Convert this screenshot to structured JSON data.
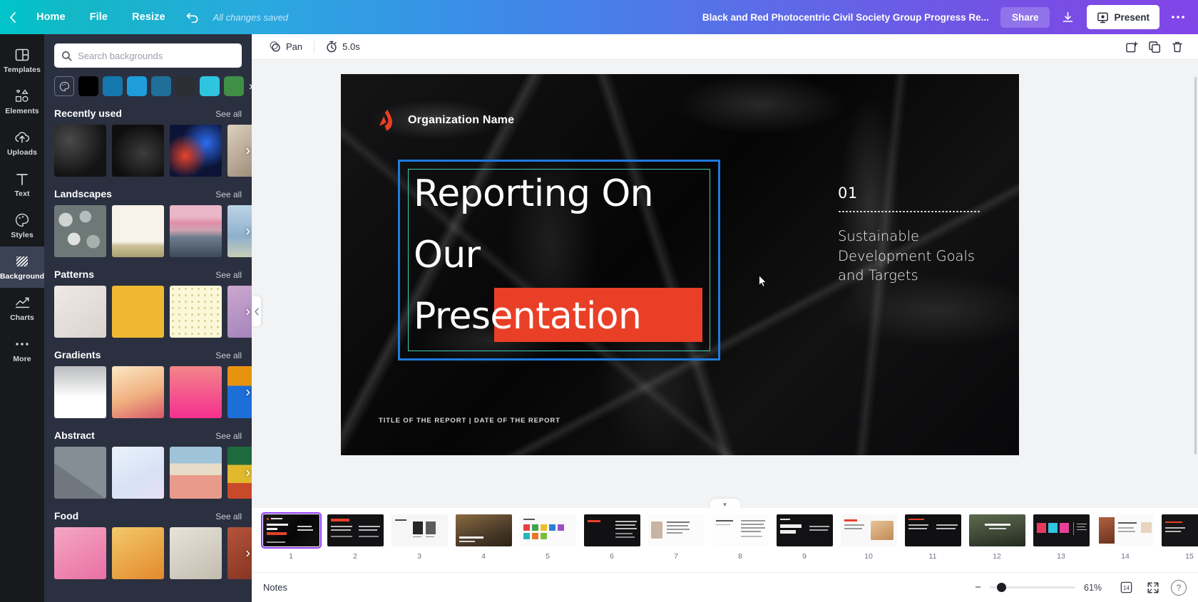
{
  "topbar": {
    "back_icon": "chevron-left-icon",
    "home": "Home",
    "file": "File",
    "resize": "Resize",
    "undo_icon": "undo-icon",
    "saved_status": "All changes saved",
    "doc_title": "Black and Red Photocentric Civil Society Group Progress Re...",
    "share": "Share",
    "download_icon": "download-icon",
    "present": "Present",
    "present_icon": "present-screen-icon",
    "more_icon": "more-horizontal-icon"
  },
  "rail": {
    "items": [
      {
        "label": "Templates",
        "icon": "templates-icon",
        "active": false
      },
      {
        "label": "Elements",
        "icon": "elements-icon",
        "active": false
      },
      {
        "label": "Uploads",
        "icon": "upload-cloud-icon",
        "active": false
      },
      {
        "label": "Text",
        "icon": "text-icon",
        "active": false
      },
      {
        "label": "Styles",
        "icon": "palette-icon",
        "active": false
      },
      {
        "label": "Background",
        "icon": "background-hatch-icon",
        "active": true
      },
      {
        "label": "Charts",
        "icon": "line-chart-icon",
        "active": false
      },
      {
        "label": "More",
        "icon": "more-dots-icon",
        "active": false
      }
    ]
  },
  "panel": {
    "search_placeholder": "Search backgrounds",
    "search_value": "",
    "search_icon": "search-icon",
    "swatches": [
      "#000000",
      "#1478ac",
      "#1e9ddb",
      "#1f6f98",
      "#2b2f33",
      "#2fc4e0",
      "#3f8f46"
    ],
    "swatch_more": "chevron-right-icon",
    "see_all": "See all",
    "sections": [
      {
        "title": "Recently used"
      },
      {
        "title": "Landscapes"
      },
      {
        "title": "Patterns"
      },
      {
        "title": "Gradients"
      },
      {
        "title": "Abstract"
      },
      {
        "title": "Food"
      }
    ],
    "collapse_icon": "chevron-left-icon"
  },
  "editor_toolbar": {
    "pan_label": "Pan",
    "pan_icon": "pan-hand-icon",
    "duration_label": "5.0s",
    "timer_icon": "timer-icon",
    "add_page_icon": "add-page-icon",
    "duplicate_icon": "duplicate-page-icon",
    "delete_icon": "trash-icon"
  },
  "slide": {
    "org_name": "Organization Name",
    "logo_icon": "brand-a-logo-icon",
    "title_lines": [
      "Reporting On",
      "Our",
      "Presentation"
    ],
    "highlight_color": "#ea3f27",
    "section_number": "01",
    "subtitle": "Sustainable Development Goals and Targets",
    "footer": "TITLE OF THE REPORT  |  DATE OF THE REPORT",
    "selection_outer_color": "#1f7ae0",
    "selection_inner_color": "#3ecfb4"
  },
  "filmstrip": {
    "pages": [
      "1",
      "2",
      "3",
      "4",
      "5",
      "6",
      "7",
      "8",
      "9",
      "10",
      "11",
      "12",
      "13",
      "14",
      "15"
    ],
    "active_page": "1",
    "handle_icon": "chevron-down-icon"
  },
  "bottombar": {
    "notes": "Notes",
    "zoom_out_icon": "minus-icon",
    "zoom_percent": "61%",
    "page_count_icon": "page-count-icon",
    "page_count": "14",
    "fullscreen_icon": "expand-icon",
    "help_icon": "question-mark-icon"
  }
}
